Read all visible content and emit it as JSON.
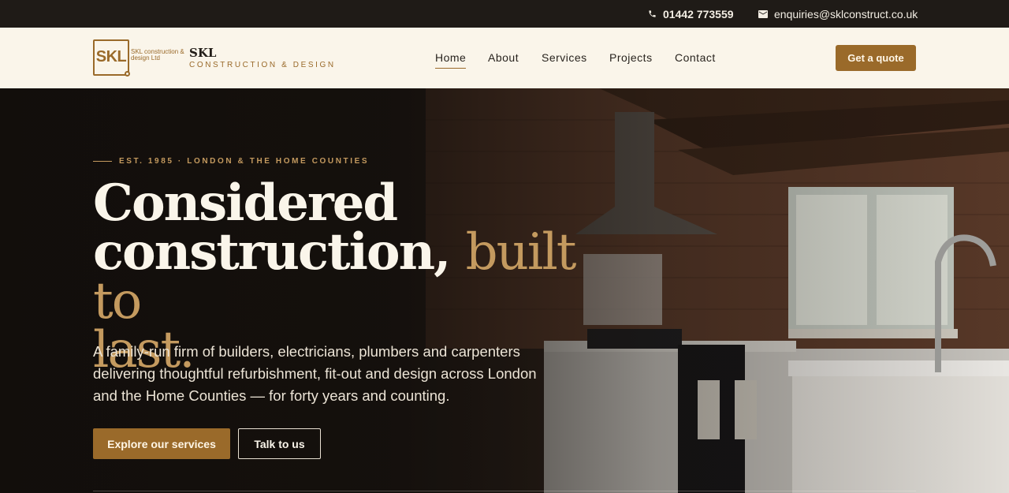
{
  "contact_bar": {
    "phone": "01442 773559",
    "email": "enquiries@sklconstruct.co.uk",
    "phone_icon": "phone-icon",
    "email_icon": "mail-icon"
  },
  "brand": {
    "mark": "SKL",
    "small_text": "SKL construction & design Ltd",
    "name": "SKL",
    "tagline": "CONSTRUCTION & DESIGN"
  },
  "nav": {
    "items": [
      {
        "label": "Home",
        "active": true
      },
      {
        "label": "About",
        "active": false
      },
      {
        "label": "Services",
        "active": false
      },
      {
        "label": "Projects",
        "active": false
      },
      {
        "label": "Contact",
        "active": false
      }
    ],
    "cta": "Get a quote"
  },
  "hero": {
    "eyebrow": "EST. 1985 · LONDON & THE HOME COUNTIES",
    "headline_line1": "Considered",
    "headline_line2_strong": "construction,",
    "headline_line2_accent": "built to",
    "headline_line3_accent": "last.",
    "lede": "A family-run firm of builders, electricians, plumbers and carpenters delivering thoughtful refurbishment, fit-out and design across London and the Home Counties — for forty years and counting.",
    "primary_button": "Explore our services",
    "secondary_button": "Talk to us"
  },
  "colors": {
    "accent": "#9a6a2a",
    "accent_light": "#c49a5f",
    "dark": "#1f1b17",
    "cream": "#faf5ea"
  }
}
